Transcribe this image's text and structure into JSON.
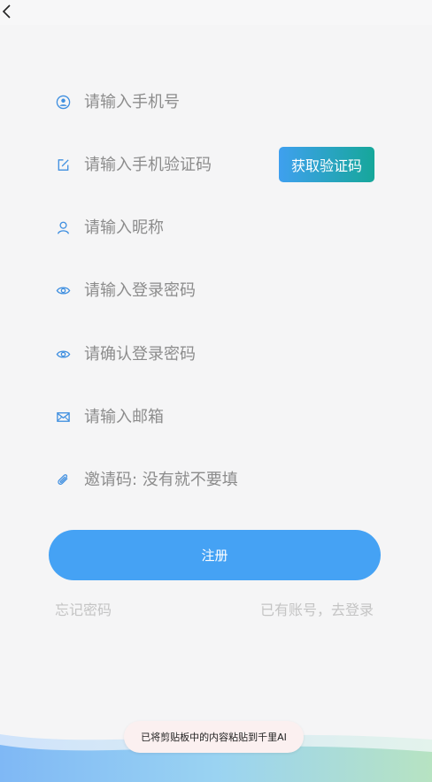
{
  "nav": {
    "back_icon": "chevron-left-icon"
  },
  "form": {
    "phone": {
      "placeholder": "请输入手机号",
      "value": "",
      "icon": "user-circle-icon"
    },
    "sms_code": {
      "placeholder": "请输入手机验证码",
      "value": "",
      "icon": "edit-icon"
    },
    "nickname": {
      "placeholder": "请输入昵称",
      "value": "",
      "icon": "person-icon"
    },
    "password": {
      "placeholder": "请输入登录密码",
      "value": "",
      "icon": "eye-icon"
    },
    "confirm_password": {
      "placeholder": "请确认登录密码",
      "value": "",
      "icon": "eye-icon"
    },
    "email": {
      "placeholder": "请输入邮箱",
      "value": "",
      "icon": "mail-icon"
    },
    "invite_code": {
      "placeholder": "邀请码: 没有就不要填",
      "value": "",
      "icon": "paperclip-icon"
    }
  },
  "get_code_label": "获取验证码",
  "register_label": "注册",
  "links": {
    "forgot_password": "忘记密码",
    "have_account": "已有账号，去登录"
  },
  "toast": {
    "message": "已将剪贴板中的内容粘贴到千里AI"
  },
  "colors": {
    "accent": "#45a2f4",
    "code_gradient_start": "#3fa0ef",
    "code_gradient_end": "#16a79a",
    "icon": "#3f8fe0",
    "link": "#c4c4c4",
    "background": "#f5f5f6"
  }
}
